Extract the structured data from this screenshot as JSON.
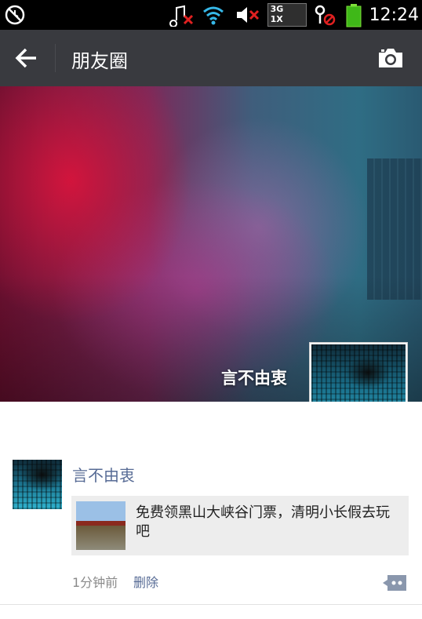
{
  "status_bar": {
    "time": "12:24",
    "network_top": "3G",
    "network_bottom": "1X",
    "icons": [
      "no-disturb-icon",
      "music-muted-icon",
      "wifi-icon",
      "volume-muted-icon",
      "signal-icon",
      "key-blocked-icon",
      "battery-icon"
    ]
  },
  "header": {
    "title": "朋友圈",
    "back_icon": "arrow-left-icon",
    "camera_icon": "camera-icon"
  },
  "cover": {
    "username": "言不由衷"
  },
  "post": {
    "author": "言不由衷",
    "share_text": "免费领黑山大峡谷门票，清明小长假去玩吧",
    "time": "1分钟前",
    "delete_label": "删除",
    "comment_icon": "comment-dots-icon"
  },
  "colors": {
    "title_bar": "#393a3f",
    "link": "#576b95",
    "card_bg": "#ededed"
  }
}
